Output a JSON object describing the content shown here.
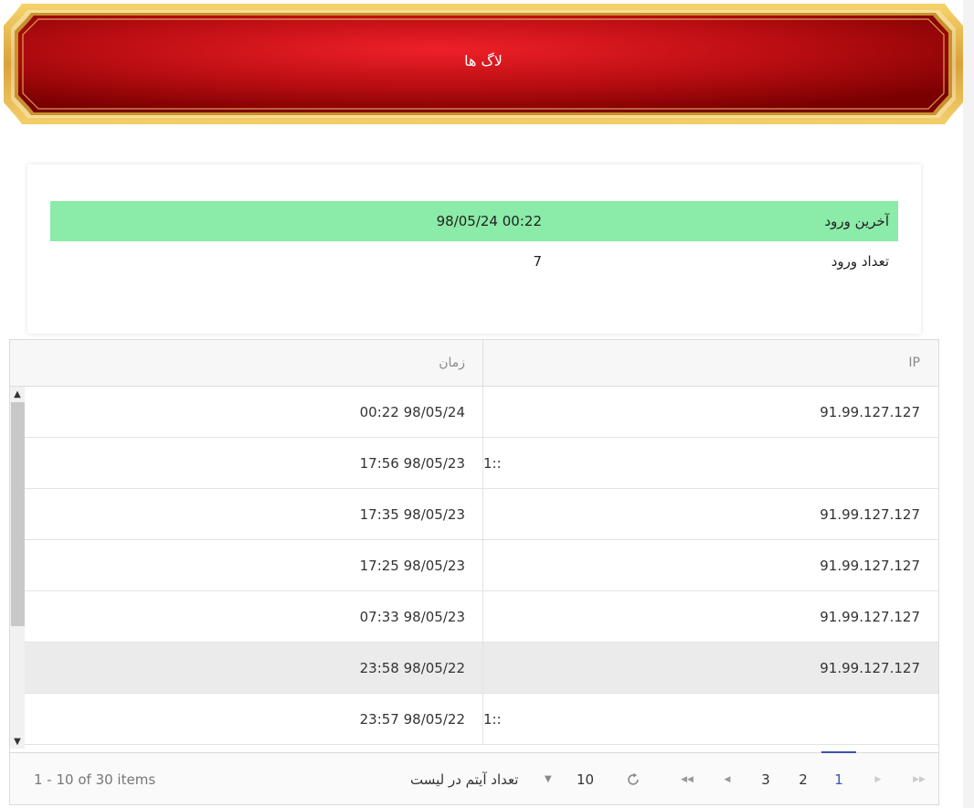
{
  "header": {
    "title": "لاگ ها"
  },
  "summary": {
    "last_login_label": "آخرین ورود",
    "last_login_value": "00:22 98/05/24",
    "login_count_label": "تعداد ورود",
    "login_count_value": "7"
  },
  "grid": {
    "columns": {
      "ip": "IP",
      "time": "زمان"
    },
    "rows": [
      {
        "ip": "91.99.127.127",
        "time": "00:22 98/05/24"
      },
      {
        "ip": "::1",
        "time": "17:56 98/05/23"
      },
      {
        "ip": "91.99.127.127",
        "time": "17:35 98/05/23"
      },
      {
        "ip": "91.99.127.127",
        "time": "17:25 98/05/23"
      },
      {
        "ip": "91.99.127.127",
        "time": "07:33 98/05/23"
      },
      {
        "ip": "91.99.127.127",
        "time": "23:58 98/05/22"
      },
      {
        "ip": "::1",
        "time": "23:57 98/05/22"
      }
    ],
    "selected_row_index": 5
  },
  "pager": {
    "info": "1 - 10 of 30 items",
    "page_size_label": "تعداد آیتم در لیست",
    "page_size_value": "10",
    "pages": [
      "1",
      "2",
      "3"
    ],
    "current_page": "1"
  },
  "colors": {
    "banner_red": "#e31e24",
    "banner_dark": "#7a0000",
    "gold": "#e9b949",
    "highlight_green": "#8beba8",
    "pager_accent": "#3f51b5"
  }
}
